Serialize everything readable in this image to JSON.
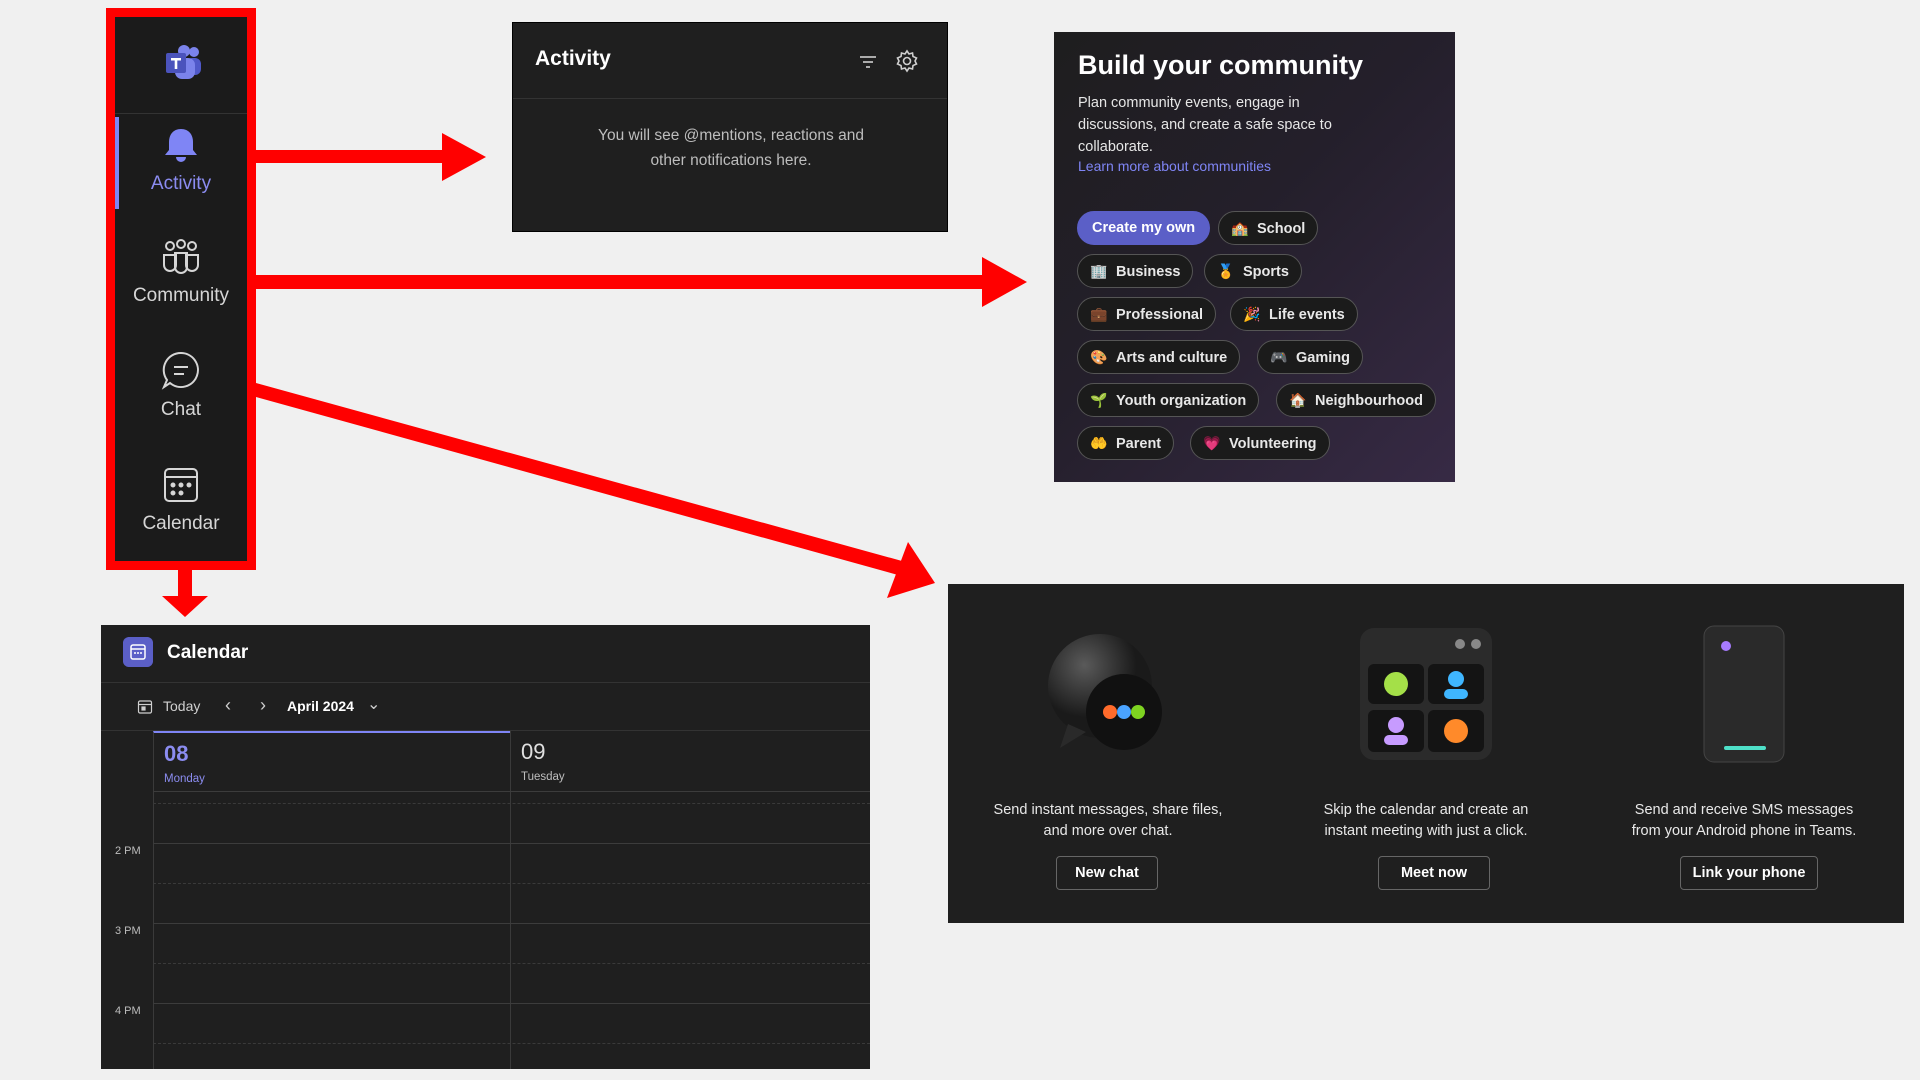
{
  "sidebar": {
    "items": [
      {
        "label": "Activity",
        "icon": "bell-icon",
        "active": true
      },
      {
        "label": "Community",
        "icon": "people-icon"
      },
      {
        "label": "Chat",
        "icon": "chat-icon"
      },
      {
        "label": "Calendar",
        "icon": "calendar-icon"
      }
    ]
  },
  "activity": {
    "title": "Activity",
    "empty_line1": "You will see @mentions, reactions and",
    "empty_line2": "other notifications here."
  },
  "community": {
    "title": "Build your community",
    "description": "Plan community events, engage in discussions, and create a safe space to collaborate.",
    "link": "Learn more about communities",
    "chips": [
      {
        "label": "Create my own",
        "primary": true
      },
      {
        "label": "School",
        "icon": "🏫"
      },
      {
        "label": "Business",
        "icon": "🏢"
      },
      {
        "label": "Sports",
        "icon": "🏅"
      },
      {
        "label": "Professional",
        "icon": "💼"
      },
      {
        "label": "Life events",
        "icon": "🎉"
      },
      {
        "label": "Arts and culture",
        "icon": "🎨"
      },
      {
        "label": "Gaming",
        "icon": "🎮"
      },
      {
        "label": "Youth organization",
        "icon": "🌱"
      },
      {
        "label": "Neighbourhood",
        "icon": "🏠"
      },
      {
        "label": "Parent",
        "icon": "🤲"
      },
      {
        "label": "Volunteering",
        "icon": "💗"
      }
    ]
  },
  "calendar": {
    "title": "Calendar",
    "today": "Today",
    "month": "April 2024",
    "days": [
      {
        "num": "08",
        "name": "Monday",
        "selected": true
      },
      {
        "num": "09",
        "name": "Tuesday"
      }
    ],
    "hours": [
      "2 PM",
      "3 PM",
      "4 PM"
    ]
  },
  "promo": {
    "cards": [
      {
        "line1": "Send instant messages, share files,",
        "line2": "and more over chat.",
        "button": "New chat"
      },
      {
        "line1": "Skip the calendar and create an",
        "line2": "instant meeting with just a click.",
        "button": "Meet now"
      },
      {
        "line1": "Send and receive SMS messages",
        "line2": "from your Android phone in Teams.",
        "button": "Link your phone"
      }
    ]
  },
  "colors": {
    "accent": "#5b5fc7",
    "highlight": "#ff0000",
    "active_nav": "#8b8cf0"
  }
}
